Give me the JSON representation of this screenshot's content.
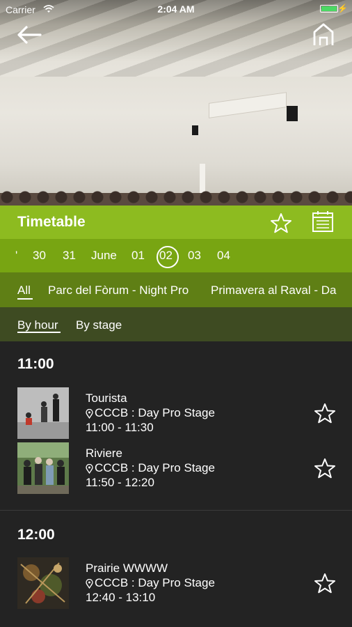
{
  "status": {
    "carrier": "Carrier",
    "time": "2:04 AM"
  },
  "header": {
    "title": "Timetable"
  },
  "dates": {
    "left_edge": "'",
    "items": [
      "30",
      "31",
      "June",
      "01",
      "02",
      "03",
      "04"
    ],
    "selected": "02"
  },
  "stages": {
    "items": [
      "All",
      "Parc del Fòrum - Night Pro",
      "Primavera al Raval - Da"
    ],
    "selected": "All"
  },
  "views": {
    "items": [
      "By hour",
      "By stage"
    ],
    "selected": "By hour"
  },
  "schedule": [
    {
      "hour": "11:00",
      "events": [
        {
          "name": "Tourista",
          "location": "CCCB : Day Pro Stage",
          "time": "11:00 - 11:30"
        },
        {
          "name": "Riviere",
          "location": "CCCB : Day Pro Stage",
          "time": "11:50 - 12:20"
        }
      ]
    },
    {
      "hour": "12:00",
      "events": [
        {
          "name": "Prairie WWWW",
          "location": "CCCB : Day Pro Stage",
          "time": "12:40 - 13:10"
        }
      ]
    }
  ],
  "icons": [
    "back-arrow-icon",
    "home-icon",
    "star-icon",
    "calendar-icon",
    "location-pin-icon"
  ],
  "colors": {
    "title_bar": "#8dbb20",
    "date_bar": "#78a512",
    "stage_bar": "#5f7f15",
    "view_bar": "#3e4b22",
    "list_bg": "#232323"
  }
}
